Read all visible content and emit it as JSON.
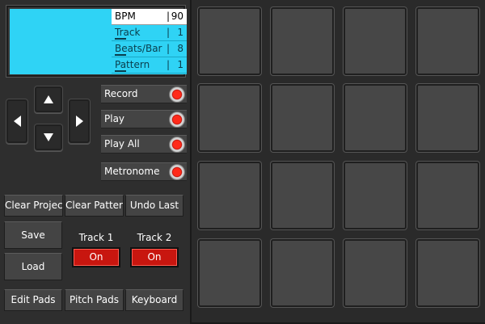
{
  "lcd": {
    "rows": [
      {
        "label": "BPM",
        "value": "90",
        "active": true
      },
      {
        "label": "Track",
        "value": "1",
        "active": false
      },
      {
        "label": "Beats/Bar",
        "value": "8",
        "active": false
      },
      {
        "label": "Pattern",
        "value": "1",
        "active": false
      }
    ],
    "separator": "|",
    "color": "#2fd3f5"
  },
  "dpad": {
    "up_icon": "arrow-up-icon",
    "down_icon": "arrow-down-icon",
    "left_icon": "arrow-left-icon",
    "right_icon": "arrow-right-icon"
  },
  "toggles": [
    {
      "label": "Record",
      "indicator": "red-led"
    },
    {
      "label": "Play",
      "indicator": "red-led"
    },
    {
      "label": "Play All",
      "indicator": "red-led"
    },
    {
      "label": "Metronome",
      "indicator": "red-led"
    }
  ],
  "actions": {
    "clear_project": "Clear Project",
    "clear_pattern": "Clear Pattern",
    "undo_last": "Undo Last",
    "save": "Save",
    "load": "Load"
  },
  "tracks": [
    {
      "label": "Track 1",
      "button": "On"
    },
    {
      "label": "Track 2",
      "button": "On"
    }
  ],
  "bottom_bar": {
    "edit_pads": "Edit Pads",
    "pitch_pads": "Pitch Pads",
    "keyboard": "Keyboard"
  },
  "pads": {
    "rows": 4,
    "cols": 4
  },
  "colors": {
    "accent_red": "#c8160f",
    "background": "#2e2e2e",
    "pad": "#474747"
  }
}
